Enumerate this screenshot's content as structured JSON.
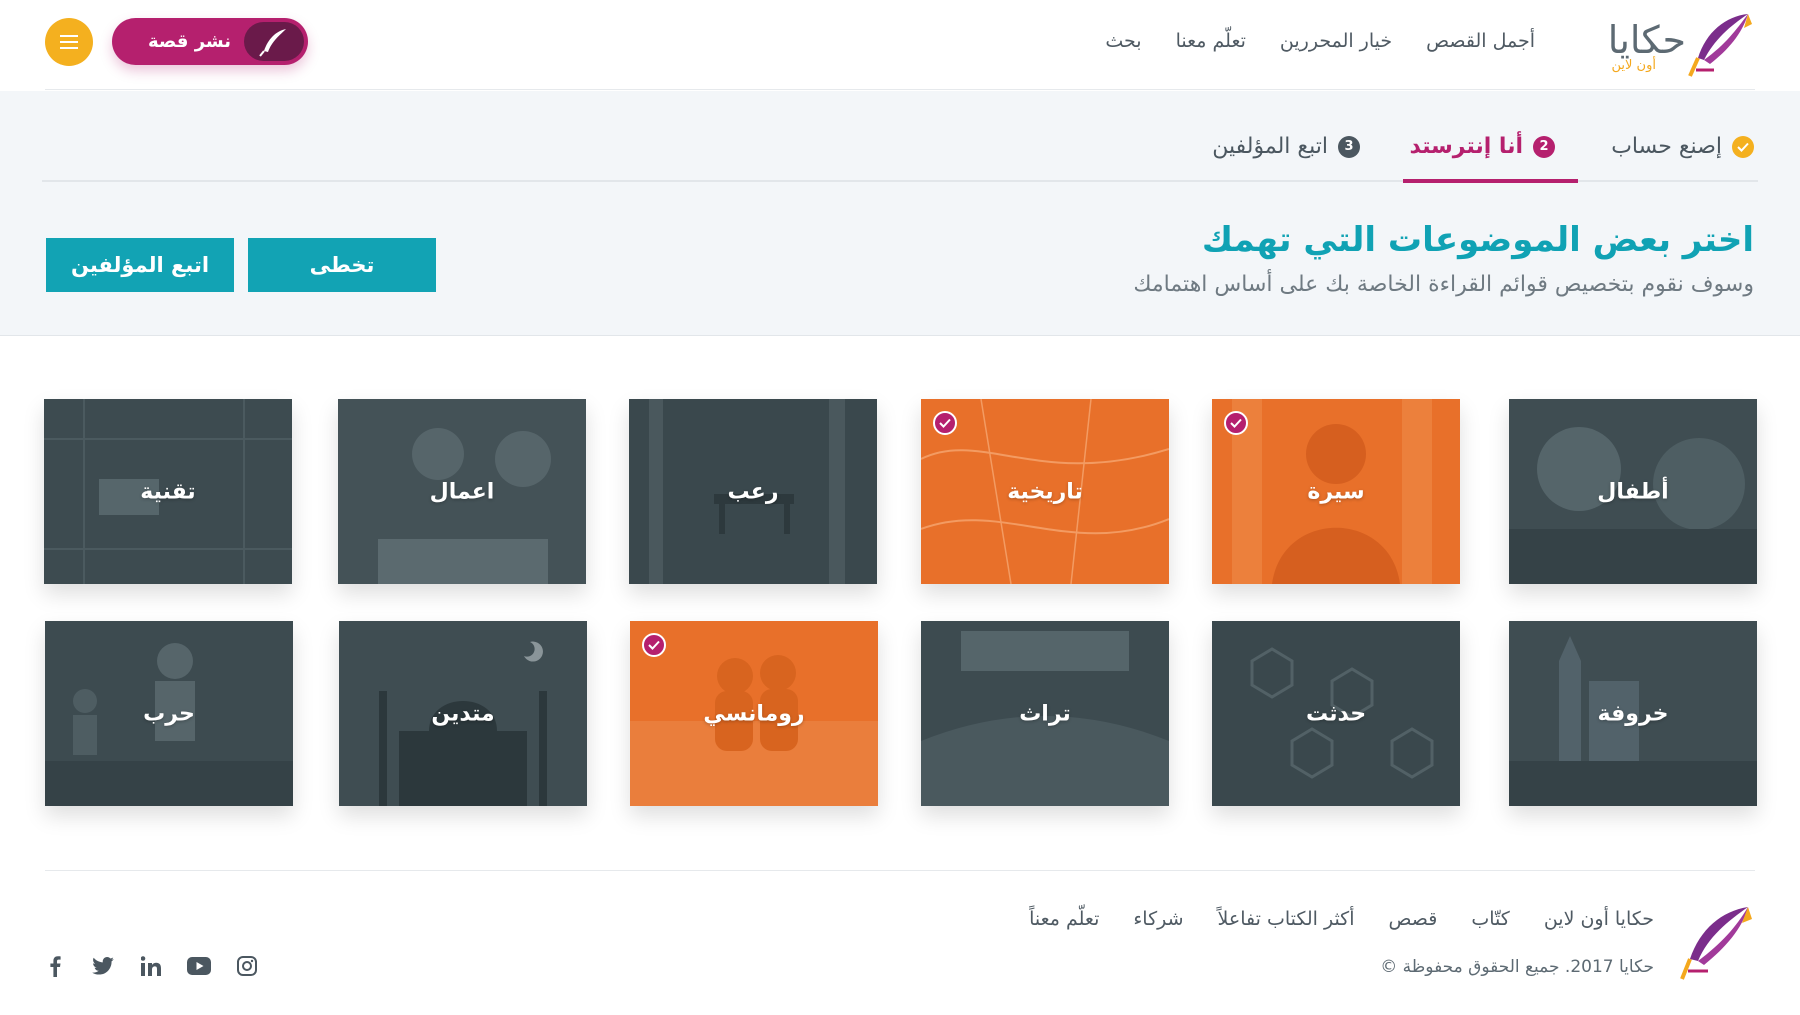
{
  "brand": {
    "name": "حكايا",
    "sub": "أون لاين"
  },
  "nav": [
    {
      "label": "أجمل القصص"
    },
    {
      "label": "خيار المحررين"
    },
    {
      "label": "تعلّم معنا"
    },
    {
      "label": "بحث"
    }
  ],
  "header": {
    "publish_label": "نشر قصة"
  },
  "steps": [
    {
      "label": "إصنع حساب",
      "state": "done"
    },
    {
      "label": "أنا إنترستد",
      "number": "2",
      "state": "active"
    },
    {
      "label": "اتبع المؤلفين",
      "number": "3",
      "state": "pending"
    }
  ],
  "intro": {
    "title": "اختر بعض الموضوعات التي تهمك",
    "subtitle": "وسوف نقوم بتخصيص قوائم القراءة الخاصة بك على أساس اهتمامك",
    "skip_label": "تخطى",
    "follow_label": "اتبع المؤلفين"
  },
  "topics": [
    {
      "label": "أطفال",
      "selected": false
    },
    {
      "label": "سيرة",
      "selected": true
    },
    {
      "label": "تاريخية",
      "selected": true
    },
    {
      "label": "رعب",
      "selected": false
    },
    {
      "label": "اعمال",
      "selected": false
    },
    {
      "label": "تقنية",
      "selected": false
    },
    {
      "label": "خروفة",
      "selected": false
    },
    {
      "label": "حدثت",
      "selected": false
    },
    {
      "label": "تراث",
      "selected": false
    },
    {
      "label": "رومانسي",
      "selected": true
    },
    {
      "label": "متدين",
      "selected": false
    },
    {
      "label": "حرب",
      "selected": false
    }
  ],
  "footer": {
    "links": [
      {
        "label": "حكايا أون لاين"
      },
      {
        "label": "كتّاب"
      },
      {
        "label": "قصص"
      },
      {
        "label": "أكثر الكتاب تفاعلاً"
      },
      {
        "label": "شركاء"
      },
      {
        "label": "تعلّم معناً"
      }
    ],
    "copyright": "© حكايا 2017. جميع الحقوق محفوظة",
    "social": [
      "facebook-icon",
      "twitter-icon",
      "linkedin-icon",
      "youtube-icon",
      "instagram-icon"
    ]
  },
  "colors": {
    "primary": "#b5206e",
    "accent": "#12a3b4",
    "yellow": "#f4b01f",
    "tile_dark": "#3b4a4f",
    "tile_selected": "#e8702a"
  }
}
